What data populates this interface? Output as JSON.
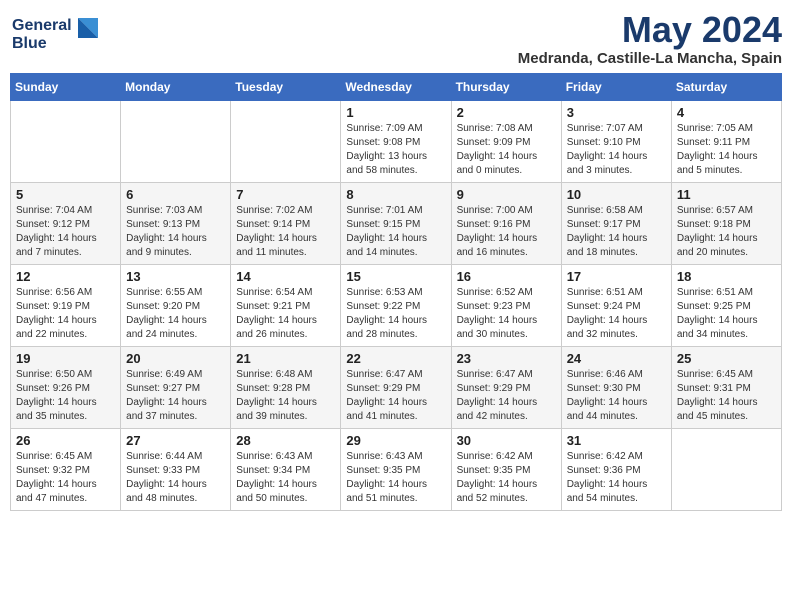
{
  "header": {
    "logo_line1": "General",
    "logo_line2": "Blue",
    "month": "May 2024",
    "location": "Medranda, Castille-La Mancha, Spain"
  },
  "days_of_week": [
    "Sunday",
    "Monday",
    "Tuesday",
    "Wednesday",
    "Thursday",
    "Friday",
    "Saturday"
  ],
  "weeks": [
    [
      {
        "day": "",
        "detail": ""
      },
      {
        "day": "",
        "detail": ""
      },
      {
        "day": "",
        "detail": ""
      },
      {
        "day": "1",
        "detail": "Sunrise: 7:09 AM\nSunset: 9:08 PM\nDaylight: 13 hours\nand 58 minutes."
      },
      {
        "day": "2",
        "detail": "Sunrise: 7:08 AM\nSunset: 9:09 PM\nDaylight: 14 hours\nand 0 minutes."
      },
      {
        "day": "3",
        "detail": "Sunrise: 7:07 AM\nSunset: 9:10 PM\nDaylight: 14 hours\nand 3 minutes."
      },
      {
        "day": "4",
        "detail": "Sunrise: 7:05 AM\nSunset: 9:11 PM\nDaylight: 14 hours\nand 5 minutes."
      }
    ],
    [
      {
        "day": "5",
        "detail": "Sunrise: 7:04 AM\nSunset: 9:12 PM\nDaylight: 14 hours\nand 7 minutes."
      },
      {
        "day": "6",
        "detail": "Sunrise: 7:03 AM\nSunset: 9:13 PM\nDaylight: 14 hours\nand 9 minutes."
      },
      {
        "day": "7",
        "detail": "Sunrise: 7:02 AM\nSunset: 9:14 PM\nDaylight: 14 hours\nand 11 minutes."
      },
      {
        "day": "8",
        "detail": "Sunrise: 7:01 AM\nSunset: 9:15 PM\nDaylight: 14 hours\nand 14 minutes."
      },
      {
        "day": "9",
        "detail": "Sunrise: 7:00 AM\nSunset: 9:16 PM\nDaylight: 14 hours\nand 16 minutes."
      },
      {
        "day": "10",
        "detail": "Sunrise: 6:58 AM\nSunset: 9:17 PM\nDaylight: 14 hours\nand 18 minutes."
      },
      {
        "day": "11",
        "detail": "Sunrise: 6:57 AM\nSunset: 9:18 PM\nDaylight: 14 hours\nand 20 minutes."
      }
    ],
    [
      {
        "day": "12",
        "detail": "Sunrise: 6:56 AM\nSunset: 9:19 PM\nDaylight: 14 hours\nand 22 minutes."
      },
      {
        "day": "13",
        "detail": "Sunrise: 6:55 AM\nSunset: 9:20 PM\nDaylight: 14 hours\nand 24 minutes."
      },
      {
        "day": "14",
        "detail": "Sunrise: 6:54 AM\nSunset: 9:21 PM\nDaylight: 14 hours\nand 26 minutes."
      },
      {
        "day": "15",
        "detail": "Sunrise: 6:53 AM\nSunset: 9:22 PM\nDaylight: 14 hours\nand 28 minutes."
      },
      {
        "day": "16",
        "detail": "Sunrise: 6:52 AM\nSunset: 9:23 PM\nDaylight: 14 hours\nand 30 minutes."
      },
      {
        "day": "17",
        "detail": "Sunrise: 6:51 AM\nSunset: 9:24 PM\nDaylight: 14 hours\nand 32 minutes."
      },
      {
        "day": "18",
        "detail": "Sunrise: 6:51 AM\nSunset: 9:25 PM\nDaylight: 14 hours\nand 34 minutes."
      }
    ],
    [
      {
        "day": "19",
        "detail": "Sunrise: 6:50 AM\nSunset: 9:26 PM\nDaylight: 14 hours\nand 35 minutes."
      },
      {
        "day": "20",
        "detail": "Sunrise: 6:49 AM\nSunset: 9:27 PM\nDaylight: 14 hours\nand 37 minutes."
      },
      {
        "day": "21",
        "detail": "Sunrise: 6:48 AM\nSunset: 9:28 PM\nDaylight: 14 hours\nand 39 minutes."
      },
      {
        "day": "22",
        "detail": "Sunrise: 6:47 AM\nSunset: 9:29 PM\nDaylight: 14 hours\nand 41 minutes."
      },
      {
        "day": "23",
        "detail": "Sunrise: 6:47 AM\nSunset: 9:29 PM\nDaylight: 14 hours\nand 42 minutes."
      },
      {
        "day": "24",
        "detail": "Sunrise: 6:46 AM\nSunset: 9:30 PM\nDaylight: 14 hours\nand 44 minutes."
      },
      {
        "day": "25",
        "detail": "Sunrise: 6:45 AM\nSunset: 9:31 PM\nDaylight: 14 hours\nand 45 minutes."
      }
    ],
    [
      {
        "day": "26",
        "detail": "Sunrise: 6:45 AM\nSunset: 9:32 PM\nDaylight: 14 hours\nand 47 minutes."
      },
      {
        "day": "27",
        "detail": "Sunrise: 6:44 AM\nSunset: 9:33 PM\nDaylight: 14 hours\nand 48 minutes."
      },
      {
        "day": "28",
        "detail": "Sunrise: 6:43 AM\nSunset: 9:34 PM\nDaylight: 14 hours\nand 50 minutes."
      },
      {
        "day": "29",
        "detail": "Sunrise: 6:43 AM\nSunset: 9:35 PM\nDaylight: 14 hours\nand 51 minutes."
      },
      {
        "day": "30",
        "detail": "Sunrise: 6:42 AM\nSunset: 9:35 PM\nDaylight: 14 hours\nand 52 minutes."
      },
      {
        "day": "31",
        "detail": "Sunrise: 6:42 AM\nSunset: 9:36 PM\nDaylight: 14 hours\nand 54 minutes."
      },
      {
        "day": "",
        "detail": ""
      }
    ]
  ]
}
